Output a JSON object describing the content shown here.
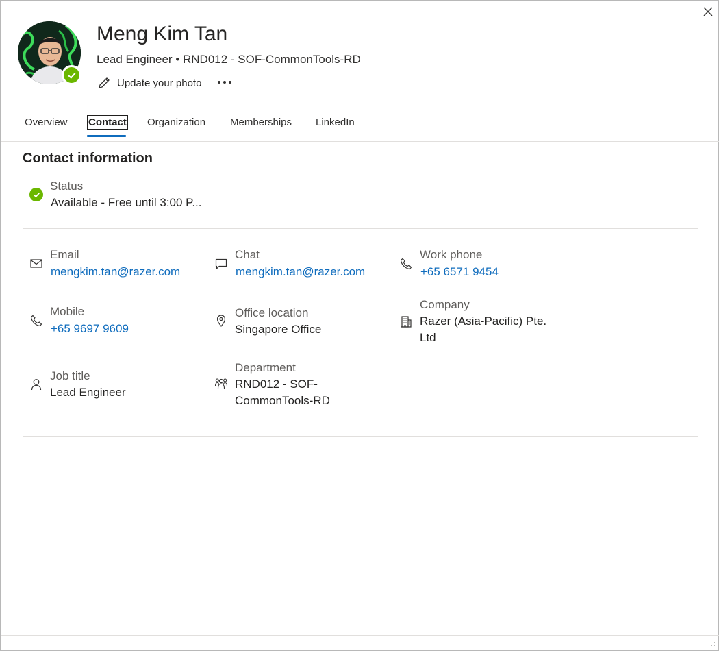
{
  "window": {
    "close_label": "Close"
  },
  "profile": {
    "name": "Meng Kim Tan",
    "subtitle": "Lead Engineer • RND012 - SOF-CommonTools-RD",
    "update_photo_label": "Update your photo",
    "presence": "available",
    "colors": {
      "presence_green": "#6bb700",
      "link_blue": "#0f6cbd"
    }
  },
  "tabs": [
    {
      "label": "Overview"
    },
    {
      "label": "Contact",
      "active": true
    },
    {
      "label": "Organization"
    },
    {
      "label": "Memberships"
    },
    {
      "label": "LinkedIn"
    }
  ],
  "contact": {
    "section_title": "Contact information",
    "status": {
      "label": "Status",
      "value": "Available - Free until 3:00 P...",
      "icon": "presence-available-icon"
    },
    "email": {
      "label": "Email",
      "value": "mengkim.tan@razer.com",
      "icon": "mail-icon"
    },
    "chat": {
      "label": "Chat",
      "value": "mengkim.tan@razer.com",
      "icon": "chat-icon"
    },
    "work_phone": {
      "label": "Work phone",
      "value": "+65 6571 9454",
      "icon": "phone-icon"
    },
    "mobile": {
      "label": "Mobile",
      "value": "+65 9697 9609",
      "icon": "phone-icon"
    },
    "office_location": {
      "label": "Office location",
      "value": "Singapore Office",
      "icon": "location-pin-icon"
    },
    "company": {
      "label": "Company",
      "value": "Razer (Asia-Pacific) Pte. Ltd",
      "icon": "building-icon"
    },
    "job_title": {
      "label": "Job title",
      "value": "Lead Engineer",
      "icon": "person-icon"
    },
    "department": {
      "label": "Department",
      "value": "RND012 - SOF-CommonTools-RD",
      "icon": "people-group-icon"
    }
  }
}
